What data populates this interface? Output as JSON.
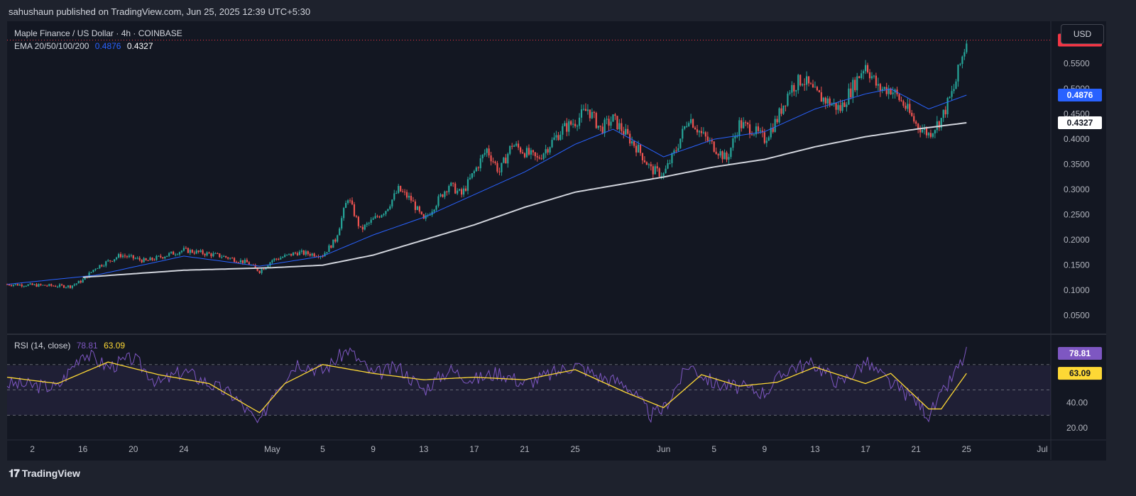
{
  "header": {
    "published": "sahushaun published on TradingView.com, Jun 25, 2025 12:39 UTC+5:30"
  },
  "footer": {
    "brand": "TradingView",
    "logo_icon": "tradingview-logo-icon"
  },
  "currency_button": "USD",
  "legend": {
    "symbol": "Maple Finance / US Dollar · 4h · COINBASE",
    "ema_label": "EMA 20/50/100/200",
    "ema_value_1": "0.4876",
    "ema_value_2": "0.4327",
    "rsi_label": "RSI (14, close)",
    "rsi_value": "78.81",
    "rsi_ma_value": "63.09"
  },
  "colors": {
    "background": "#131722",
    "up": "#26a69a",
    "down": "#ef5350",
    "ema_fast": "#2962ff",
    "ema_slow": "#d1d4dc",
    "rsi": "#7e57c2",
    "rsi_ma": "#fdd835",
    "price_badge": "#f23645"
  },
  "chart_data": [
    {
      "type": "candlestick",
      "title": "Maple Finance / US Dollar · 4h · COINBASE",
      "x_ticks": [
        "2",
        "16",
        "20",
        "24",
        "May",
        "5",
        "9",
        "13",
        "17",
        "21",
        "25",
        "Jun",
        "5",
        "9",
        "13",
        "17",
        "21",
        "25",
        "Jul"
      ],
      "y_ticks": [
        0.05,
        0.1,
        0.15,
        0.2,
        0.25,
        0.3,
        0.35,
        0.4,
        0.45,
        0.5,
        0.55
      ],
      "y_tick_labels": [
        "0.0500",
        "0.1000",
        "0.1500",
        "0.2000",
        "0.2500",
        "0.3000",
        "0.3500",
        "0.4000",
        "0.4500",
        "0.5000",
        "0.5500"
      ],
      "ylim": [
        0.02,
        0.62
      ],
      "last_price": "0.5967",
      "price_path": [
        [
          "Apr 10",
          0.112
        ],
        [
          "Apr 15",
          0.108
        ],
        [
          "Apr 16",
          0.12
        ],
        [
          "Apr 17",
          0.145
        ],
        [
          "Apr 19",
          0.17
        ],
        [
          "Apr 21",
          0.158
        ],
        [
          "Apr 24",
          0.18
        ],
        [
          "Apr 27",
          0.168
        ],
        [
          "Apr 29",
          0.155
        ],
        [
          "Apr 30",
          0.138
        ],
        [
          "May 1",
          0.16
        ],
        [
          "May 3",
          0.175
        ],
        [
          "May 5",
          0.17
        ],
        [
          "May 6",
          0.2
        ],
        [
          "May 7",
          0.285
        ],
        [
          "May 8",
          0.22
        ],
        [
          "May 10",
          0.26
        ],
        [
          "May 11",
          0.3
        ],
        [
          "May 12",
          0.28
        ],
        [
          "May 13",
          0.238
        ],
        [
          "May 15",
          0.31
        ],
        [
          "May 16",
          0.29
        ],
        [
          "May 18",
          0.38
        ],
        [
          "May 19",
          0.335
        ],
        [
          "May 20",
          0.39
        ],
        [
          "May 22",
          0.36
        ],
        [
          "May 24",
          0.42
        ],
        [
          "May 25",
          0.435
        ],
        [
          "May 26",
          0.46
        ],
        [
          "May 27",
          0.42
        ],
        [
          "May 28",
          0.44
        ],
        [
          "May 30",
          0.38
        ],
        [
          "May 31",
          0.34
        ],
        [
          "Jun 1",
          0.33
        ],
        [
          "Jun 2",
          0.38
        ],
        [
          "Jun 3",
          0.445
        ],
        [
          "Jun 4",
          0.41
        ],
        [
          "Jun 6",
          0.36
        ],
        [
          "Jun 7",
          0.43
        ],
        [
          "Jun 8",
          0.42
        ],
        [
          "Jun 9",
          0.4
        ],
        [
          "Jun 10",
          0.44
        ],
        [
          "Jun 11",
          0.5
        ],
        [
          "Jun 12",
          0.52
        ],
        [
          "Jun 13",
          0.49
        ],
        [
          "Jun 15",
          0.46
        ],
        [
          "Jun 17",
          0.55
        ],
        [
          "Jun 18",
          0.5
        ],
        [
          "Jun 19",
          0.5
        ],
        [
          "Jun 20",
          0.47
        ],
        [
          "Jun 21",
          0.43
        ],
        [
          "Jun 22",
          0.41
        ],
        [
          "Jun 23",
          0.44
        ],
        [
          "Jun 24",
          0.5
        ],
        [
          "Jun 25",
          0.5967
        ]
      ],
      "series": [
        {
          "name": "EMA 20/50/100/200",
          "value": "0.4876",
          "values": [
            [
              "Apr 10",
              0.112
            ],
            [
              "Apr 17",
              0.13
            ],
            [
              "Apr 24",
              0.168
            ],
            [
              "Apr 30",
              0.148
            ],
            [
              "May 5",
              0.168
            ],
            [
              "May 9",
              0.21
            ],
            [
              "May 13",
              0.245
            ],
            [
              "May 17",
              0.29
            ],
            [
              "May 21",
              0.335
            ],
            [
              "May 25",
              0.39
            ],
            [
              "May 28",
              0.42
            ],
            [
              "Jun 1",
              0.365
            ],
            [
              "Jun 5",
              0.4
            ],
            [
              "Jun 9",
              0.415
            ],
            [
              "Jun 13",
              0.46
            ],
            [
              "Jun 17",
              0.49
            ],
            [
              "Jun 19",
              0.5
            ],
            [
              "Jun 22",
              0.46
            ],
            [
              "Jun 25",
              0.4876
            ]
          ]
        },
        {
          "name": "EMA 20/50/100/200",
          "value": "0.4327",
          "values": [
            [
              "Apr 16",
              0.126
            ],
            [
              "Apr 24",
              0.14
            ],
            [
              "May 1",
              0.145
            ],
            [
              "May 5",
              0.15
            ],
            [
              "May 9",
              0.17
            ],
            [
              "May 13",
              0.2
            ],
            [
              "May 17",
              0.23
            ],
            [
              "May 21",
              0.265
            ],
            [
              "May 25",
              0.295
            ],
            [
              "Jun 1",
              0.325
            ],
            [
              "Jun 5",
              0.345
            ],
            [
              "Jun 9",
              0.36
            ],
            [
              "Jun 13",
              0.385
            ],
            [
              "Jun 17",
              0.405
            ],
            [
              "Jun 21",
              0.42
            ],
            [
              "Jun 25",
              0.4327
            ]
          ]
        }
      ]
    },
    {
      "type": "line",
      "title": "RSI (14, close)",
      "y_ticks": [
        20,
        40
      ],
      "y_tick_labels": [
        "20.00",
        "40.00"
      ],
      "bands": [
        30,
        50,
        70
      ],
      "ylim": [
        15,
        90
      ],
      "series": [
        {
          "name": "RSI (14, close)",
          "value": "78.81",
          "values": [
            [
              "Apr 10",
              55
            ],
            [
              "Apr 14",
              52
            ],
            [
              "Apr 16",
              80
            ],
            [
              "Apr 18",
              68
            ],
            [
              "Apr 20",
              75
            ],
            [
              "Apr 22",
              55
            ],
            [
              "Apr 24",
              65
            ],
            [
              "Apr 26",
              55
            ],
            [
              "Apr 28",
              45
            ],
            [
              "Apr 30",
              22
            ],
            [
              "May 1",
              48
            ],
            [
              "May 3",
              72
            ],
            [
              "May 5",
              65
            ],
            [
              "May 7",
              82
            ],
            [
              "May 9",
              62
            ],
            [
              "May 11",
              68
            ],
            [
              "May 13",
              50
            ],
            [
              "May 15",
              66
            ],
            [
              "May 17",
              58
            ],
            [
              "May 19",
              64
            ],
            [
              "May 21",
              55
            ],
            [
              "May 23",
              62
            ],
            [
              "May 25",
              70
            ],
            [
              "May 27",
              60
            ],
            [
              "May 29",
              55
            ],
            [
              "May 31",
              30
            ],
            [
              "Jun 1",
              35
            ],
            [
              "Jun 3",
              70
            ],
            [
              "Jun 5",
              55
            ],
            [
              "Jun 7",
              52
            ],
            [
              "Jun 9",
              48
            ],
            [
              "Jun 11",
              68
            ],
            [
              "Jun 13",
              70
            ],
            [
              "Jun 15",
              55
            ],
            [
              "Jun 17",
              72
            ],
            [
              "Jun 19",
              55
            ],
            [
              "Jun 21",
              42
            ],
            [
              "Jun 22",
              30
            ],
            [
              "Jun 23",
              45
            ],
            [
              "Jun 24",
              62
            ],
            [
              "Jun 25",
              78.81
            ]
          ]
        },
        {
          "name": "RSI-based MA",
          "value": "63.09",
          "values": [
            [
              "Apr 10",
              60
            ],
            [
              "Apr 14",
              55
            ],
            [
              "Apr 18",
              72
            ],
            [
              "Apr 22",
              62
            ],
            [
              "Apr 26",
              55
            ],
            [
              "Apr 30",
              32
            ],
            [
              "May 2",
              55
            ],
            [
              "May 5",
              70
            ],
            [
              "May 9",
              63
            ],
            [
              "May 13",
              58
            ],
            [
              "May 17",
              60
            ],
            [
              "May 21",
              58
            ],
            [
              "May 25",
              66
            ],
            [
              "May 29",
              48
            ],
            [
              "Jun 1",
              36
            ],
            [
              "Jun 4",
              62
            ],
            [
              "Jun 7",
              53
            ],
            [
              "Jun 10",
              56
            ],
            [
              "Jun 13",
              68
            ],
            [
              "Jun 17",
              55
            ],
            [
              "Jun 19",
              63
            ],
            [
              "Jun 22",
              35
            ],
            [
              "Jun 23",
              35
            ],
            [
              "Jun 25",
              63.09
            ]
          ]
        }
      ]
    }
  ]
}
